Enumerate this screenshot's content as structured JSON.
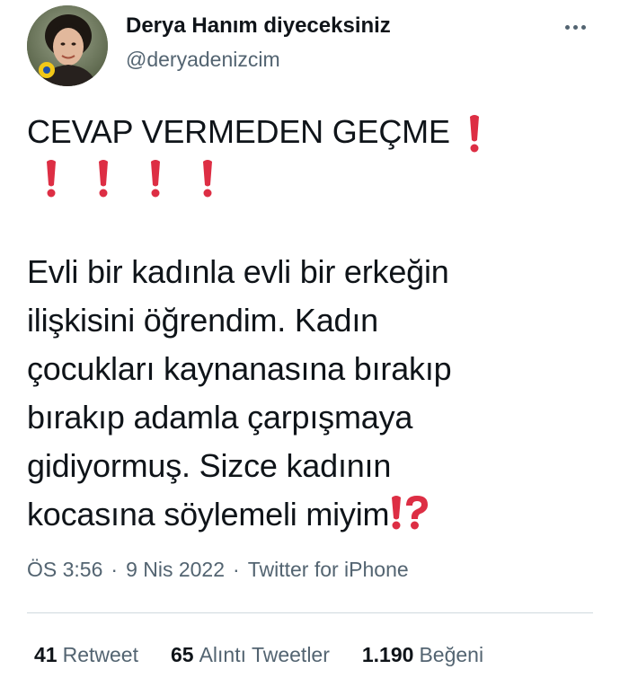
{
  "author": {
    "display_name": "Derya Hanım diyeceksiniz",
    "handle": "@deryadenizcim"
  },
  "menu": {
    "more_icon": "more-horizontal-icon"
  },
  "tweet": {
    "headline": "CEVAP VERMEDEN GEÇME",
    "headline_emoji": "heavy-exclamation-mark-icon",
    "exclamation_count": 5,
    "body_lines": [
      "Evli bir kadınla evli bir erkeğin",
      "ilişkisini öğrendim. Kadın",
      "çocukları kaynanasına bırakıp",
      "bırakıp adamla çarpışmaya",
      "gidiyormuş. Sizce kadının",
      "kocasına söylemeli miyim"
    ],
    "trailing_emoji": "exclamation-question-mark-icon",
    "emoji_color": "#dd2e44"
  },
  "meta": {
    "time": "ÖS 3:56",
    "separator": "·",
    "date": "9 Nis 2022",
    "source": "Twitter for iPhone"
  },
  "stats": {
    "retweets_count": "41",
    "retweets_label": "Retweet",
    "quotes_count": "65",
    "quotes_label": "Alıntı Tweetler",
    "likes_count": "1.190",
    "likes_label": "Beğeni"
  },
  "colors": {
    "text": "#0f1419",
    "secondary": "#536471",
    "divider": "#cfd9de",
    "emoji_red": "#dd2e44"
  }
}
